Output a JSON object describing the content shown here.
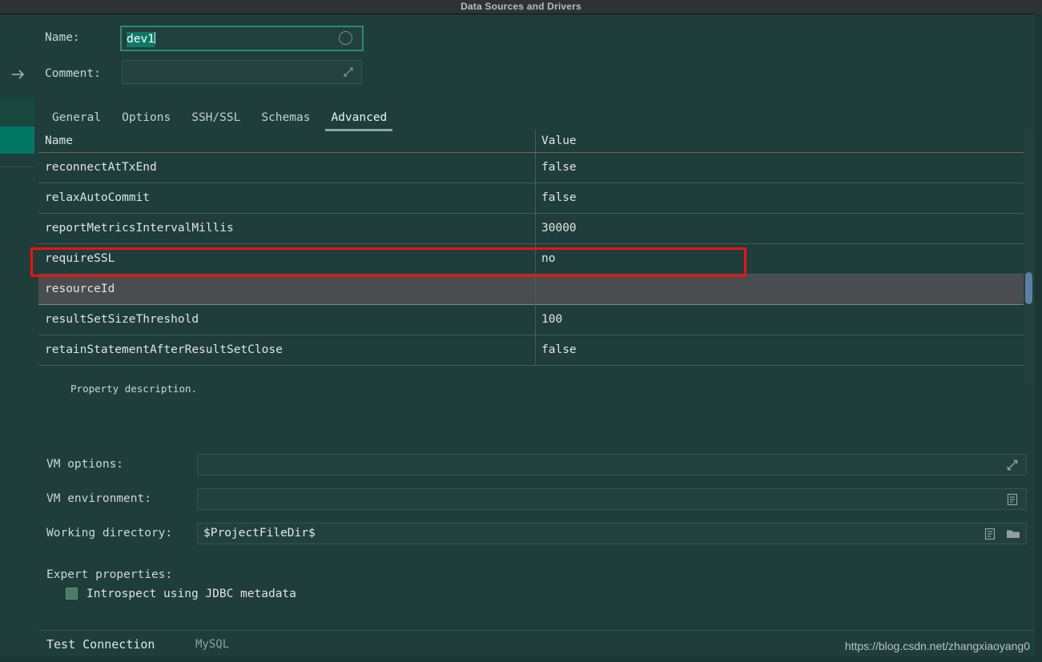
{
  "window": {
    "title": "Data Sources and Drivers"
  },
  "sidebar": {
    "arrow_icon": "arrow-right-icon"
  },
  "form": {
    "name_label": "Name:",
    "name_value": "dev1",
    "comment_label": "Comment:",
    "comment_value": "",
    "comment_expand_icon": "expand-icon",
    "name_status_icon": "circle-icon"
  },
  "tabs": [
    {
      "label": "General",
      "active": false
    },
    {
      "label": "Options",
      "active": false
    },
    {
      "label": "SSH/SSL",
      "active": false
    },
    {
      "label": "Schemas",
      "active": false
    },
    {
      "label": "Advanced",
      "active": true
    }
  ],
  "table": {
    "columns": [
      "Name",
      "Value"
    ],
    "rows": [
      {
        "name": "reconnectAtTxEnd",
        "value": "false",
        "selected": false,
        "highlighted": false
      },
      {
        "name": "relaxAutoCommit",
        "value": "false",
        "selected": false,
        "highlighted": false
      },
      {
        "name": "reportMetricsIntervalMillis",
        "value": "30000",
        "selected": false,
        "highlighted": false
      },
      {
        "name": "requireSSL",
        "value": "no",
        "selected": false,
        "highlighted": true
      },
      {
        "name": "resourceId",
        "value": "",
        "selected": true,
        "highlighted": false
      },
      {
        "name": "resultSetSizeThreshold",
        "value": "100",
        "selected": false,
        "highlighted": false
      },
      {
        "name": "retainStatementAfterResultSetClose",
        "value": "false",
        "selected": false,
        "highlighted": false
      }
    ]
  },
  "description": "Property description.",
  "bottom_form": {
    "vm_options_label": "VM options:",
    "vm_options_value": "",
    "vm_options_icon": "expand-icon",
    "vm_environment_label": "VM environment:",
    "vm_environment_value": "",
    "vm_environment_icon": "list-icon",
    "working_directory_label": "Working directory:",
    "working_directory_value": "$ProjectFileDir$",
    "working_directory_list_icon": "list-icon",
    "working_directory_folder_icon": "folder-icon",
    "expert_properties_label": "Expert properties:",
    "introspect_label": "Introspect using JDBC metadata",
    "introspect_checked": true
  },
  "footer": {
    "test_connection": "Test Connection",
    "driver": "MySQL",
    "watermark": "https://blog.csdn.net/zhangxiaoyang0"
  },
  "colors": {
    "background": "#1f3d3b",
    "titlebar": "#2f3234",
    "accent": "#007864",
    "selected_row": "#494d4f",
    "highlight_box": "#f01010",
    "scrollbar_thumb": "#5c7fa2",
    "tab_underline": "#85aaa3"
  }
}
